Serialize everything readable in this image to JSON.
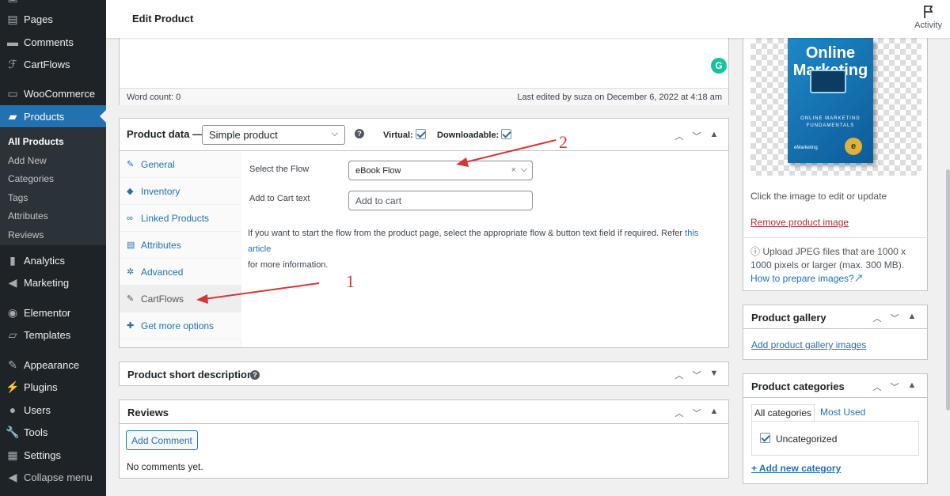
{
  "sidebar": {
    "items": [
      {
        "label": "Pages",
        "icon": "pages-icon"
      },
      {
        "label": "Comments",
        "icon": "comments-icon"
      },
      {
        "label": "CartFlows",
        "icon": "cartflows-icon"
      },
      {
        "label": "WooCommerce",
        "icon": "woocommerce-icon"
      },
      {
        "label": "Products",
        "icon": "products-icon"
      },
      {
        "label": "Analytics",
        "icon": "analytics-icon"
      },
      {
        "label": "Marketing",
        "icon": "marketing-icon"
      },
      {
        "label": "Elementor",
        "icon": "elementor-icon"
      },
      {
        "label": "Templates",
        "icon": "templates-icon"
      },
      {
        "label": "Appearance",
        "icon": "appearance-icon"
      },
      {
        "label": "Plugins",
        "icon": "plugins-icon"
      },
      {
        "label": "Users",
        "icon": "users-icon"
      },
      {
        "label": "Tools",
        "icon": "tools-icon"
      },
      {
        "label": "Settings",
        "icon": "settings-icon"
      },
      {
        "label": "Collapse menu",
        "icon": "collapse-icon"
      }
    ],
    "submenu": [
      "All Products",
      "Add New",
      "Categories",
      "Tags",
      "Attributes",
      "Reviews"
    ]
  },
  "header": {
    "title": "Edit Product",
    "activity_label": "Activity"
  },
  "editor": {
    "word_count": "Word count: 0",
    "last_edited": "Last edited by suza on December 6, 2022 at 4:18 am"
  },
  "product_data": {
    "title": "Product data —",
    "type_value": "Simple product",
    "virtual_label": "Virtual:",
    "downloadable_label": "Downloadable:",
    "tabs": [
      "General",
      "Inventory",
      "Linked Products",
      "Attributes",
      "Advanced",
      "CartFlows",
      "Get more options"
    ],
    "flow_label": "Select the Flow",
    "flow_value": "eBook Flow",
    "cart_label": "Add to Cart text",
    "cart_placeholder": "Add to cart",
    "help_text": "If you want to start the flow from the product page, select the appropriate flow & button text field if required. Refer",
    "help_link": "this article",
    "help_text_2": "for more information."
  },
  "annotations": {
    "one": "1",
    "two": "2"
  },
  "short_description": {
    "title": "Product short description"
  },
  "reviews": {
    "title": "Reviews",
    "add_button": "Add Comment",
    "empty": "No comments yet."
  },
  "product_image": {
    "book_title": "Online Marketing",
    "book_subtitle": "ONLINE MARKETING FUNDAMENTALS",
    "book_brand": "eMarketing",
    "edit_hint": "Click the image to edit or update",
    "remove_link": "Remove product image",
    "upload_info": "Upload JPEG files that are 1000 x 1000 pixels or larger (max. 300 MB).",
    "prepare_link": "How to prepare images?"
  },
  "gallery": {
    "title": "Product gallery",
    "add_link": "Add product gallery images"
  },
  "categories": {
    "title": "Product categories",
    "tab_all": "All categories",
    "tab_most": "Most Used",
    "item": "Uncategorized",
    "add_link": "+ Add new category"
  },
  "colors": {
    "accent": "#2271b1",
    "sidebar_bg": "#1d2327",
    "annotation_red": "#d63638"
  }
}
